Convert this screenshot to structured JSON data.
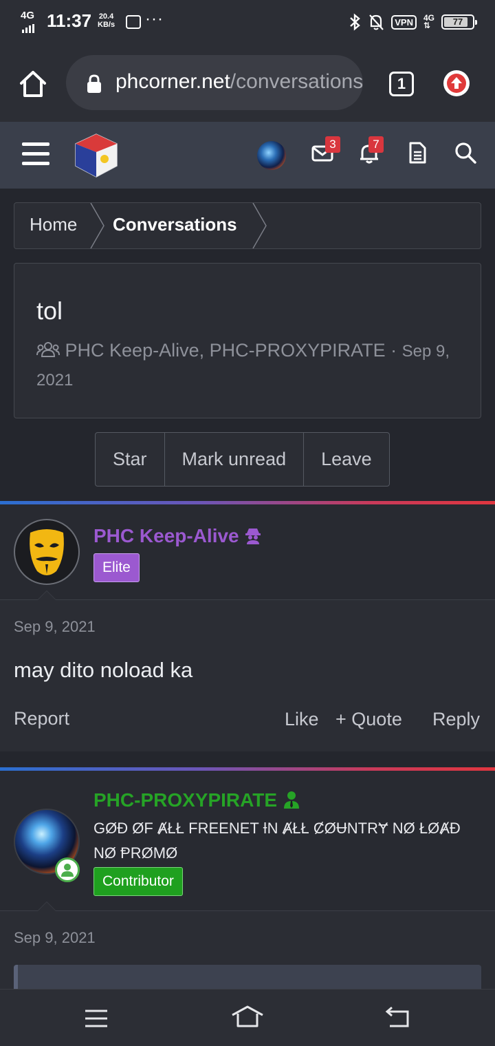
{
  "status_bar": {
    "network": "4G",
    "time": "11:37",
    "speed_value": "20.4",
    "speed_unit": "KB/s",
    "more": "···",
    "vpn": "VPN",
    "net_type": "4G",
    "battery": "77"
  },
  "browser": {
    "url_host": "phcorner.net",
    "url_path": "/conversations/",
    "tab_count": "1"
  },
  "site_nav": {
    "messages_count": "3",
    "alerts_count": "7"
  },
  "breadcrumb": {
    "home": "Home",
    "current": "Conversations"
  },
  "conversation": {
    "title": "tol",
    "participants": "PHC Keep-Alive, PHC-PROXYPIRATE",
    "separator": "·",
    "date": "Sep 9, 2021"
  },
  "actions": {
    "star": "Star",
    "mark_unread": "Mark unread",
    "leave": "Leave"
  },
  "posts": [
    {
      "username": "PHC Keep-Alive",
      "username_color": "#9b59d0",
      "role": "Elite",
      "role_color": "#9b59d0",
      "date": "Sep 9, 2021",
      "text": "may dito noload ka",
      "report": "Report",
      "like": "Like",
      "quote": "Quote",
      "reply": "Reply"
    },
    {
      "username": "PHC-PROXYPIRATE",
      "username_color": "#26a326",
      "title_line1": "GØĐ ØF ȺŁŁ FREENET ƗN ȺŁŁ ȻØɄNTRɎ NØ ŁØȺĐ",
      "title_line2": "NØ ⱣRØMØ",
      "role": "Contributor",
      "role_color": "#1fa01f",
      "date": "Sep 9, 2021"
    }
  ]
}
